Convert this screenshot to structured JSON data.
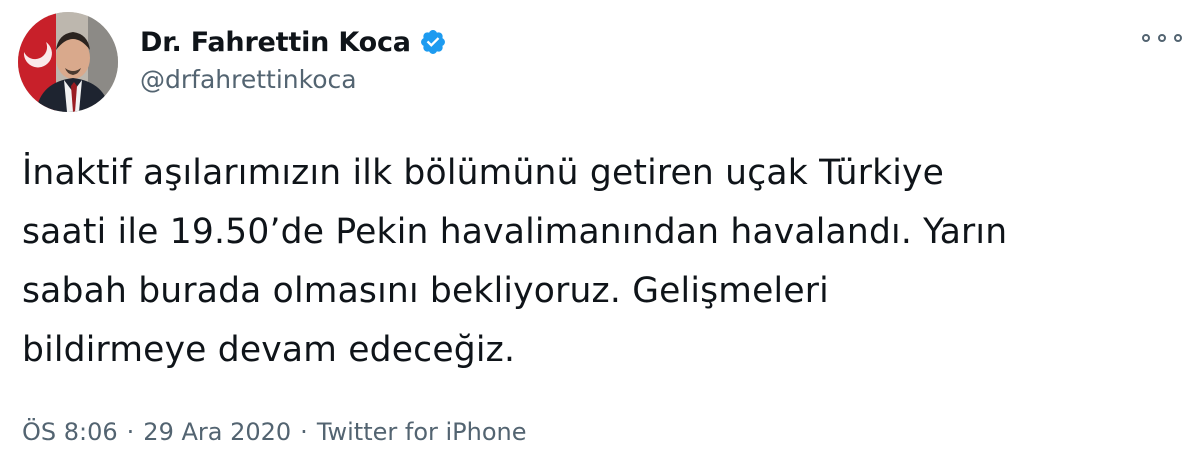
{
  "author": {
    "display_name": "Dr. Fahrettin Koca",
    "handle": "@drfahrettinkoca",
    "verified": true,
    "avatar_icon": "user-avatar"
  },
  "tweet": {
    "lines": [
      "İnaktif aşılarımızın ilk bölümünü getiren uçak Türkiye",
      "saati ile 19.50’de Pekin havalimanından havalandı. Yarın",
      "sabah burada olmasını bekliyoruz. Gelişmeleri",
      "bildirmeye devam edeceğiz."
    ]
  },
  "meta": {
    "time": "ÖS 8:06",
    "separator": "·",
    "date": "29 Ara 2020",
    "source": "Twitter for iPhone"
  },
  "icons": {
    "verified": "verified-badge-icon",
    "more": "more-options-icon"
  },
  "colors": {
    "text_primary": "#0f1419",
    "text_secondary": "#536471",
    "verified_blue": "#1d9bf0",
    "background": "#ffffff"
  }
}
